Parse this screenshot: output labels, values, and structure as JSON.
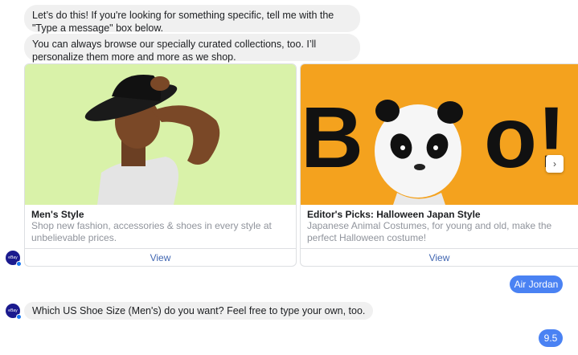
{
  "messages": {
    "bot_1": "Let’s do this! If you're looking for something specific, tell me with the \"Type a message\" box below.",
    "bot_2": "You can always browse our specially curated collections, too. I’ll personalize them more and more as we shop.",
    "bot_3": "Which US Shoe Size (Men's) do you want?  Feel free to type your own, too."
  },
  "cards": [
    {
      "title": "Men's Style",
      "subtitle": "Shop new fashion, accessories & shoes in every style at unbelievable prices.",
      "button": "View"
    },
    {
      "title": "Editor's Picks: Halloween Japan Style",
      "subtitle": "Japanese Animal Costumes, for young and old, make the perfect Halloween costume!",
      "button": "View",
      "image_text": "B     o!"
    }
  ],
  "user_replies": [
    "Air Jordan",
    "9.5"
  ],
  "avatar": {
    "label": "eBay"
  },
  "colors": {
    "accent": "#4a82f3",
    "link": "#4267b2",
    "bot_bubble": "#f0f0f0",
    "card1_bg": "#d9f2a9",
    "card2_bg": "#f4a21e"
  },
  "icons": {
    "carousel_next": "chevron-right-icon"
  }
}
